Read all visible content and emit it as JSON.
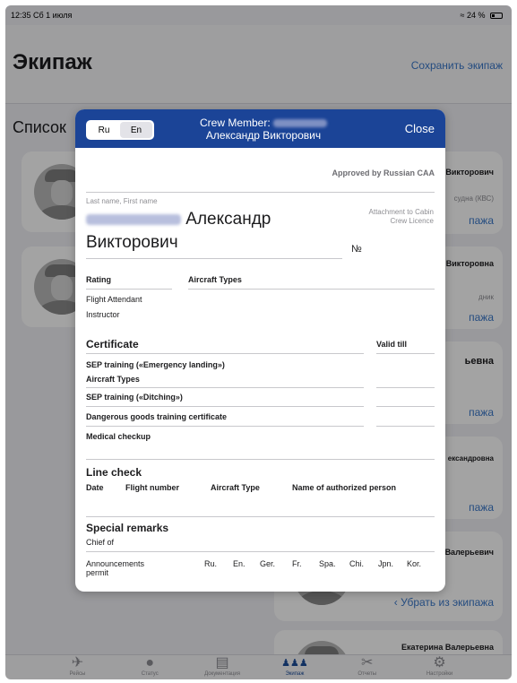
{
  "status_bar": {
    "time_date": "12:35  Сб 1 июля",
    "wifi": "≈",
    "battery": "24 %"
  },
  "nav": {
    "title": "Экипаж",
    "save_label": "Сохранить экипаж"
  },
  "section_title": "Список",
  "cards": [
    {
      "name": "Викторович",
      "role": "судна (КВС)",
      "action": "пажа"
    },
    {
      "name": "Викторовна",
      "role": "дник",
      "action": "пажа"
    },
    {
      "name": "ьевна",
      "role": "",
      "action": "пажа"
    },
    {
      "name": "ександровна",
      "role": "",
      "action": "пажа"
    },
    {
      "name": "Валерьевич",
      "role": "",
      "action": "Убрать из экипажа",
      "chevron": "‹"
    },
    {
      "name": "Екатерина Валерьевна",
      "role": ""
    }
  ],
  "tabbar": {
    "items": [
      {
        "icon": "airplane-icon",
        "glyph": "✈",
        "label": "Рейсы",
        "active": false
      },
      {
        "icon": "checkmark-circle-icon",
        "glyph": "●",
        "label": "Статус",
        "active": false
      },
      {
        "icon": "document-icon",
        "glyph": "▤",
        "label": "Документация",
        "active": false
      },
      {
        "icon": "crew-icon",
        "glyph": "♟♟♟",
        "label": "Экипаж",
        "active": true
      },
      {
        "icon": "tools-icon",
        "glyph": "✂",
        "label": "Отчеты",
        "active": false
      },
      {
        "icon": "settings-icon",
        "glyph": "⚙",
        "label": "Настройки",
        "active": false
      }
    ]
  },
  "modal": {
    "lang_ru": "Ru",
    "lang_en": "En",
    "selected_lang": "En",
    "title_line1": "Crew Member:",
    "title_line2": "Александр Викторович",
    "close_label": "Close",
    "approved": "Approved by Russian CAA",
    "name_label": "Last name, First name",
    "first_name": "Александр",
    "patronymic": "Викторович",
    "attachment_label": "Attachment to Cabin Crew Licence",
    "number_sign": "№",
    "rating_header": "Rating",
    "aircraft_types_header": "Aircraft Types",
    "rating_values": [
      "Flight Attendant",
      "Instructor"
    ],
    "certificate_header": "Certificate",
    "valid_till_header": "Valid till",
    "certificates": [
      "SEP training («Emergency landing»)",
      "Aircraft Types",
      "SEP training («Ditching»)",
      "Dangerous goods training certificate",
      "Medical checkup"
    ],
    "line_check_header": "Line check",
    "line_check_columns": [
      "Date",
      "Flight number",
      "Aircraft Type",
      "Name of authorized person"
    ],
    "special_remarks_header": "Special remarks",
    "chief_of": "Chief of",
    "announcements_label": "Announcements permit",
    "announcement_langs": [
      "Ru.",
      "En.",
      "Ger.",
      "Fr.",
      "Spa.",
      "Chi.",
      "Jpn.",
      "Kor."
    ]
  },
  "colors": {
    "header_blue": "#1b4497",
    "link_blue": "#3a78c9",
    "dim_overlay": "rgba(0,0,0,0.36)"
  }
}
